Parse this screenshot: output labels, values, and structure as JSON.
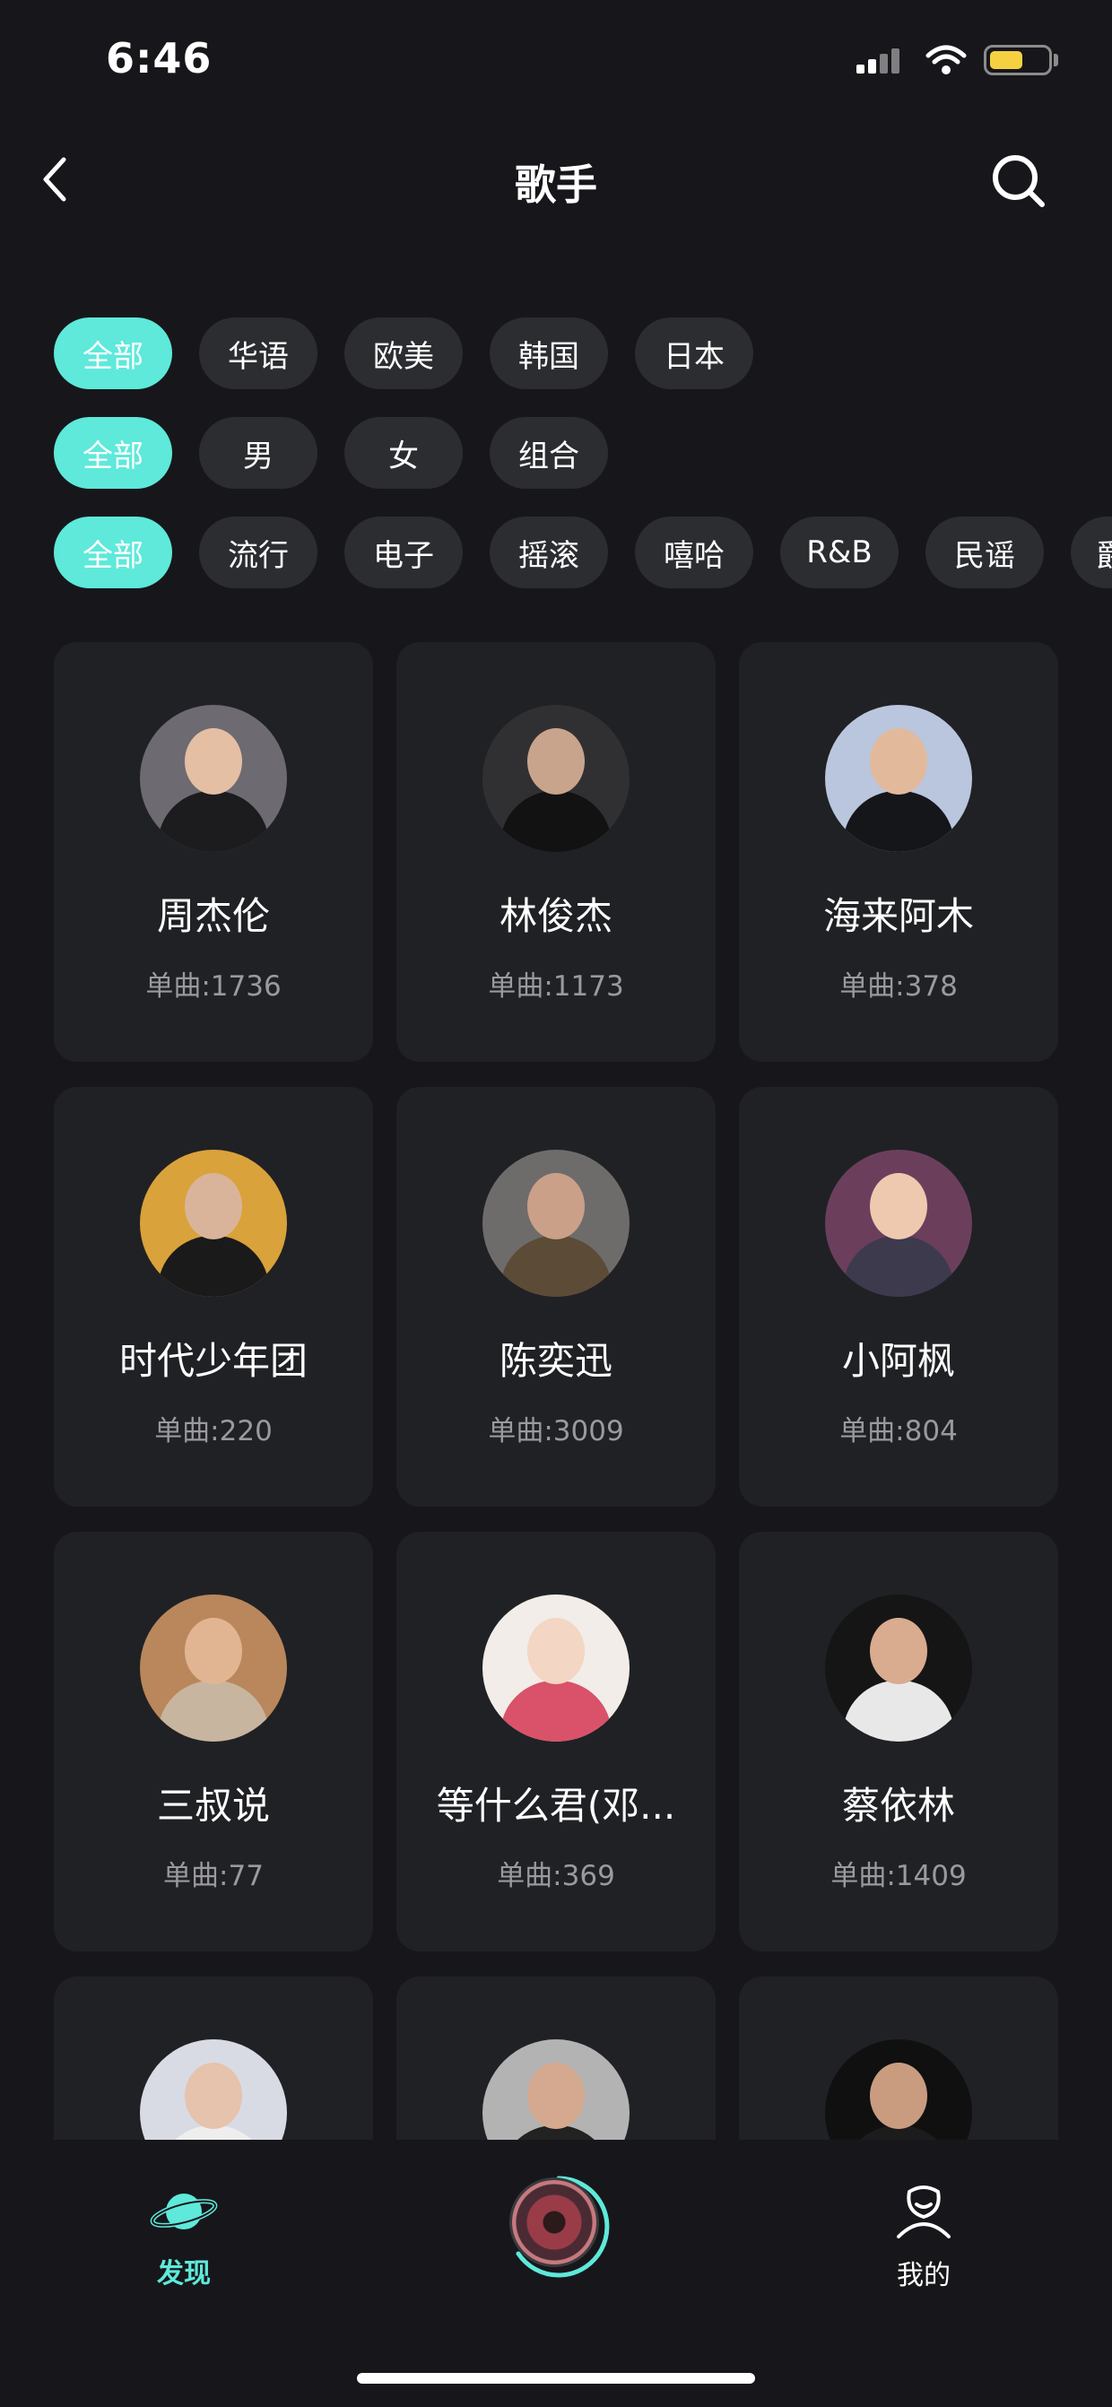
{
  "status_bar": {
    "time": "6:46"
  },
  "header": {
    "title": "歌手"
  },
  "filters": {
    "region": [
      "全部",
      "华语",
      "欧美",
      "韩国",
      "日本"
    ],
    "gender": [
      "全部",
      "男",
      "女",
      "组合"
    ],
    "genre": [
      "全部",
      "流行",
      "电子",
      "摇滚",
      "嘻哈",
      "R&B",
      "民谣",
      "爵"
    ]
  },
  "artists": [
    {
      "name": "周杰伦",
      "songs": "单曲:1736"
    },
    {
      "name": "林俊杰",
      "songs": "单曲:1173"
    },
    {
      "name": "海来阿木",
      "songs": "单曲:378"
    },
    {
      "name": "时代少年团",
      "songs": "单曲:220"
    },
    {
      "name": "陈奕迅",
      "songs": "单曲:3009"
    },
    {
      "name": "小阿枫",
      "songs": "单曲:804"
    },
    {
      "name": "三叔说",
      "songs": "单曲:77"
    },
    {
      "name": "等什么君(邓...",
      "songs": "单曲:369"
    },
    {
      "name": "蔡依林",
      "songs": "单曲:1409"
    }
  ],
  "bottom_nav": {
    "discover_label": "发现",
    "mine_label": "我的"
  },
  "colors": {
    "accent": "#5ee9da",
    "background": "#17171b",
    "card": "#202125",
    "chip": "#2c2d31"
  }
}
